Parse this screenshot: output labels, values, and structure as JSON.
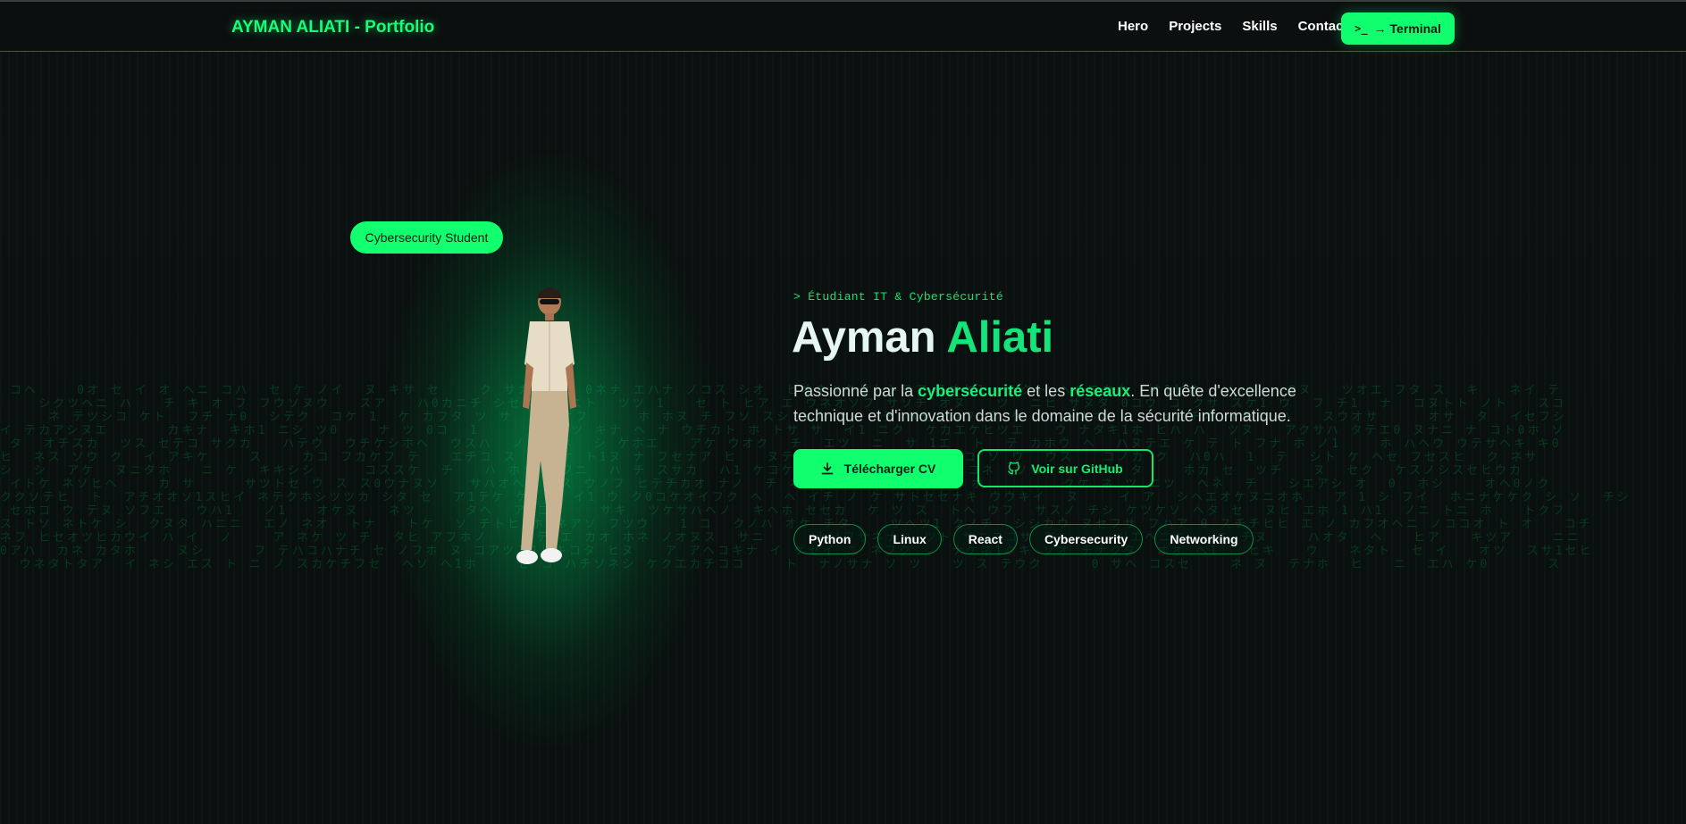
{
  "header": {
    "brand": "AYMAN ALIATI - Portfolio",
    "nav": [
      "Hero",
      "Projects",
      "Skills",
      "Contact"
    ],
    "terminal_label": "→ Terminal",
    "terminal_icon": "terminal-icon"
  },
  "hero": {
    "badge": "Cybersecurity Student",
    "kicker": "> Étudiant IT & Cybersécurité",
    "title_first": "Ayman",
    "title_last": "Aliati",
    "desc": {
      "p1": "Passionné par la ",
      "h1": "cybersécurité",
      "p2": " et les ",
      "h2": "réseaux",
      "p3": ". En quête d'excellence technique et d'innovation dans le domaine de la sécurité informatique."
    },
    "cv_label": "Télécharger CV",
    "github_label": "Voir sur GitHub",
    "tags": [
      "Python",
      "Linux",
      "React",
      "Cybersecurity",
      "Networking"
    ]
  },
  "colors": {
    "accent": "#11ff6e",
    "background": "#0a0f0e"
  }
}
